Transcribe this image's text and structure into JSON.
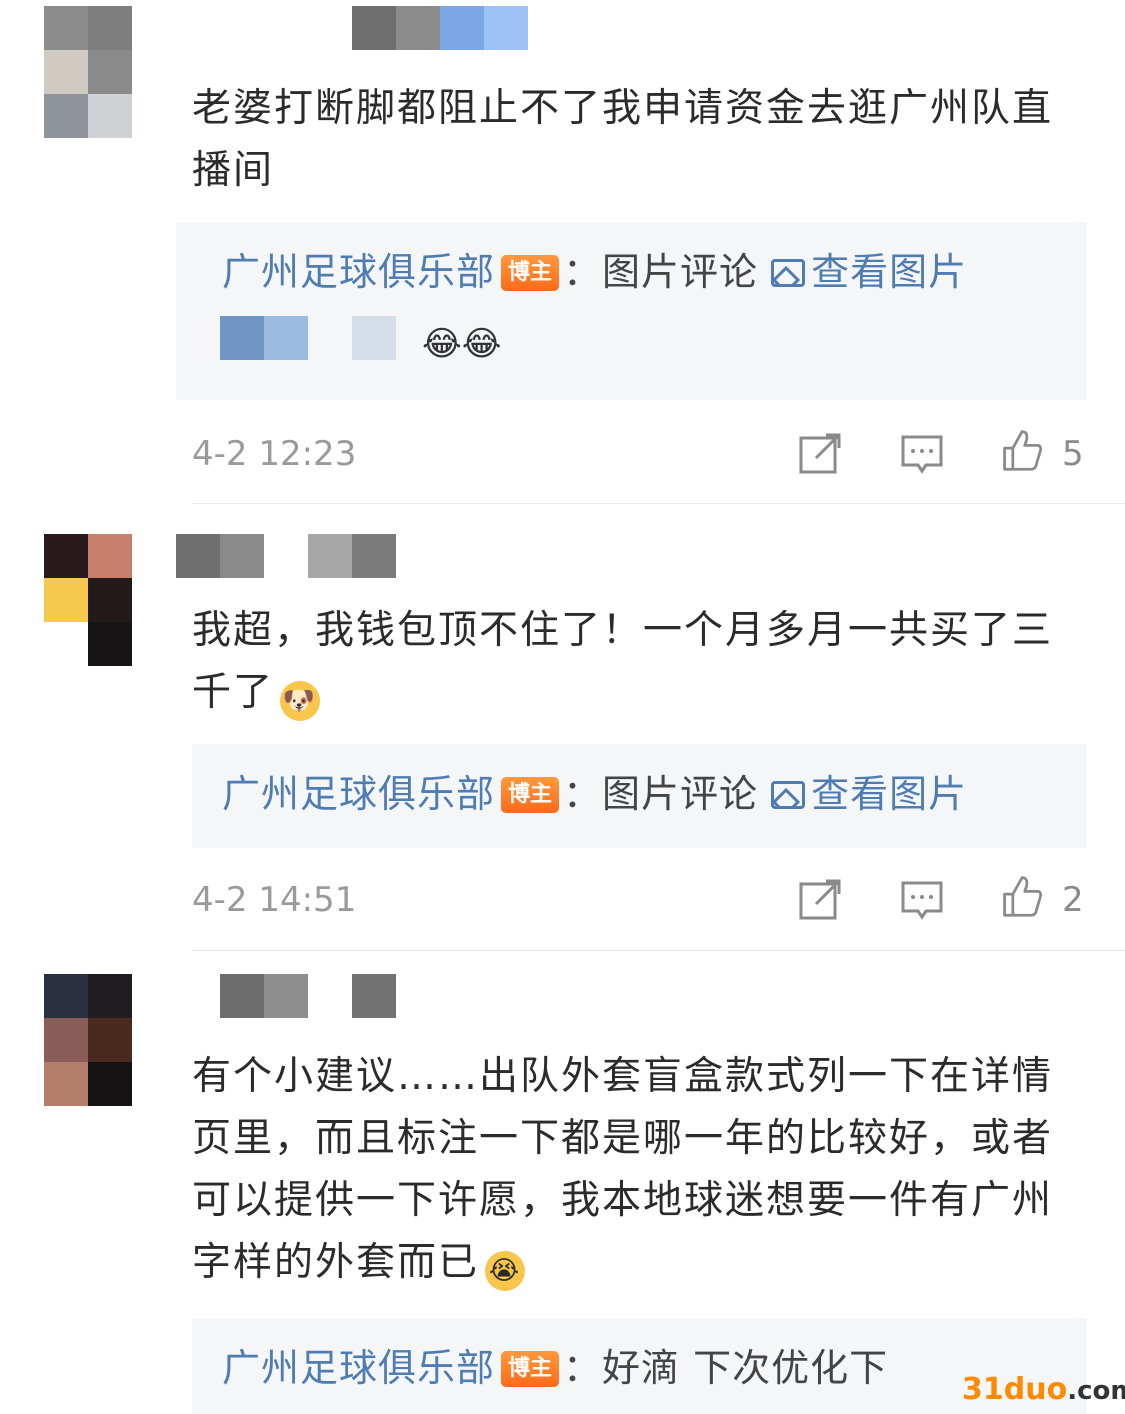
{
  "comments": [
    {
      "text": "老婆打断脚都阻止不了我申请资金去逛广州队直播间",
      "reply": {
        "author": "广州足球俱乐部",
        "badge": "博主",
        "separator": "：",
        "content": "图片评论",
        "view_pic": "查看图片",
        "emoji": "😂😂"
      },
      "time": "4-2 12:23",
      "likes": "5"
    },
    {
      "text": "我超，我钱包顶不住了！一个月多月一共买了三千了",
      "emoji": "🐶",
      "reply": {
        "author": "广州足球俱乐部",
        "badge": "博主",
        "separator": "：",
        "content": "图片评论",
        "view_pic": "查看图片"
      },
      "time": "4-2 14:51",
      "likes": "2"
    },
    {
      "text": "有个小建议……出队外套盲盒款式列一下在详情页里，而且标注一下都是哪一年的比较好，或者可以提供一下许愿，我本地球迷想要一件有广州字样的外套而已",
      "emoji": "😭",
      "reply": {
        "author": "广州足球俱乐部",
        "badge": "博主",
        "separator": "：",
        "content": "好滴 下次优化下"
      }
    }
  ],
  "watermark": {
    "brand": "31duo",
    "suffix": ".com"
  }
}
